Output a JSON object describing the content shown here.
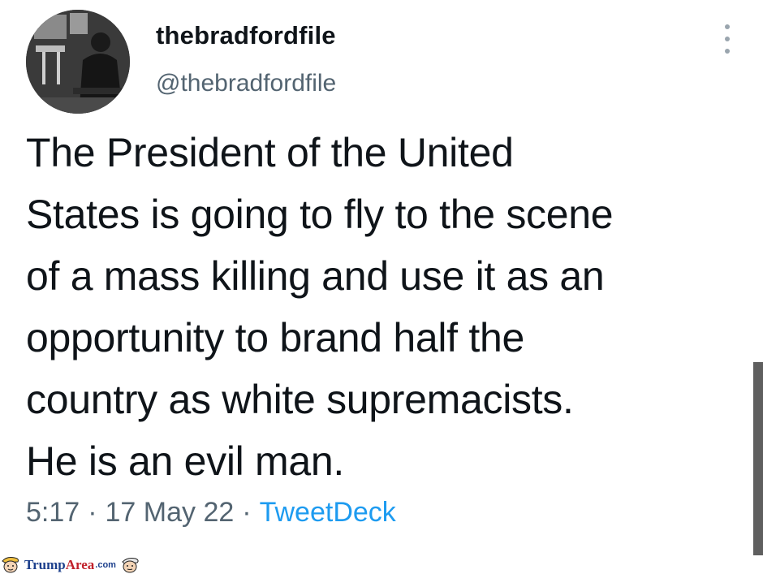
{
  "tweet": {
    "display_name": "thebradfordfile",
    "handle": "@thebradfordfile",
    "text": "The President of the United\nStates is going to fly to the scene\nof a mass killing and use it as an\nopportunity to brand half the\ncountry as white supremacists.\nHe is an evil man.",
    "time": "5:17",
    "date": "17 May 22",
    "source": "TweetDeck",
    "separator": "·",
    "avatar_icon": "profile-photo",
    "more_icon": "more-options-icon"
  },
  "watermark": {
    "brand_part1": "Trump",
    "brand_part2": "Area",
    "brand_suffix": ".com",
    "brand_colors": {
      "trump": "#1c3f8c",
      "area": "#c0202a"
    }
  },
  "colors": {
    "text": "#0f1419",
    "secondary": "#536471",
    "link": "#1d9bf0"
  }
}
